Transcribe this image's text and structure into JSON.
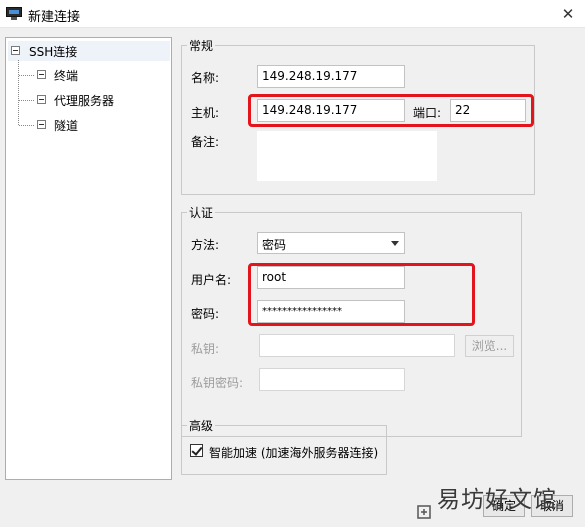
{
  "window": {
    "title": "新建连接",
    "close_glyph": "✕"
  },
  "tree": {
    "root": "SSH连接",
    "children": [
      "终端",
      "代理服务器",
      "隧道"
    ]
  },
  "general": {
    "legend": "常规",
    "name_label": "名称:",
    "name_value": "149.248.19.177",
    "host_label": "主机:",
    "host_value": "149.248.19.177",
    "port_label": "端口:",
    "port_value": "22",
    "notes_label": "备注:"
  },
  "auth": {
    "legend": "认证",
    "method_label": "方法:",
    "method_value": "密码",
    "username_label": "用户名:",
    "username_value": "root",
    "password_label": "密码:",
    "password_value": "****************",
    "private_key_label": "私钥:",
    "browse_label": "浏览...",
    "key_password_label": "私钥密码:"
  },
  "advanced": {
    "legend": "高级",
    "smart_accel_label": "智能加速 (加速海外服务器连接)",
    "smart_accel_checked": true
  },
  "footer": {
    "ok_label": "确定",
    "cancel_label": "取消"
  },
  "watermark": {
    "text": "易坊好文馆"
  },
  "colors": {
    "highlight": "#e3141b",
    "dialog_bg": "#f0f0f0"
  }
}
